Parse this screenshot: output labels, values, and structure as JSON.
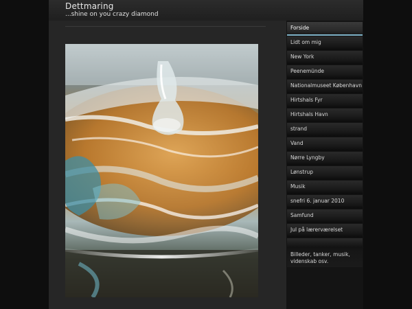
{
  "header": {
    "title": "Dettmaring",
    "tagline": "...shine on you crazy diamond"
  },
  "nav": {
    "items": [
      {
        "label": "Forside",
        "active": true
      },
      {
        "label": "Lidt om mig"
      },
      {
        "label": "New York"
      },
      {
        "label": "Peenemünde"
      },
      {
        "label": "Nationalmuseet København"
      },
      {
        "label": "Hirtshals Fyr"
      },
      {
        "label": "Hirtshals Havn"
      },
      {
        "label": "strand"
      },
      {
        "label": "Vand"
      },
      {
        "label": "Nørre Lyngby"
      },
      {
        "label": "Lønstrup"
      },
      {
        "label": "Musik"
      },
      {
        "label": "snefri 6. januar 2010"
      },
      {
        "label": "Samfund"
      },
      {
        "label": "Jul på lærerværelset"
      }
    ]
  },
  "sidebar": {
    "description": "Billeder, tanker, musik, videnskab osv."
  },
  "colors": {
    "accent": "#7fb3c8",
    "background": "#262626",
    "sidebar": "#141414"
  }
}
